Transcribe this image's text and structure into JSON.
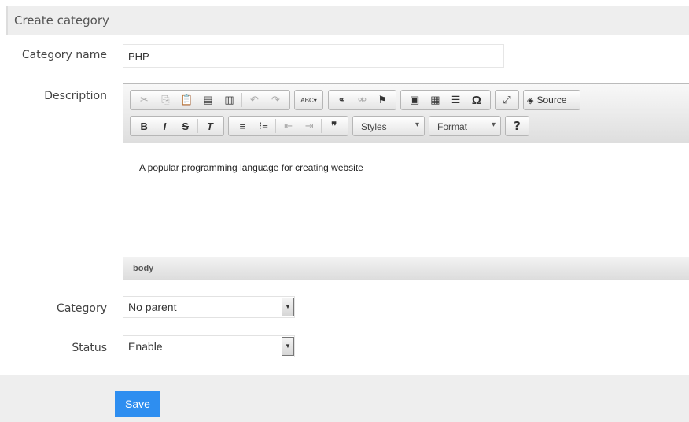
{
  "header": {
    "title": "Create category"
  },
  "form": {
    "name_label": "Category name",
    "name_value": "PHP",
    "description_label": "Description",
    "description_text": "A popular programming language for creating website",
    "editor_path": "body",
    "category_label": "Category",
    "category_value": "No parent",
    "status_label": "Status",
    "status_value": "Enable"
  },
  "toolbar": {
    "source": "Source",
    "styles": "Styles",
    "format": "Format",
    "help": "?",
    "spell": "ABC▾",
    "omega": "Ω",
    "quote": "❞"
  },
  "actions": {
    "save": "Save"
  }
}
